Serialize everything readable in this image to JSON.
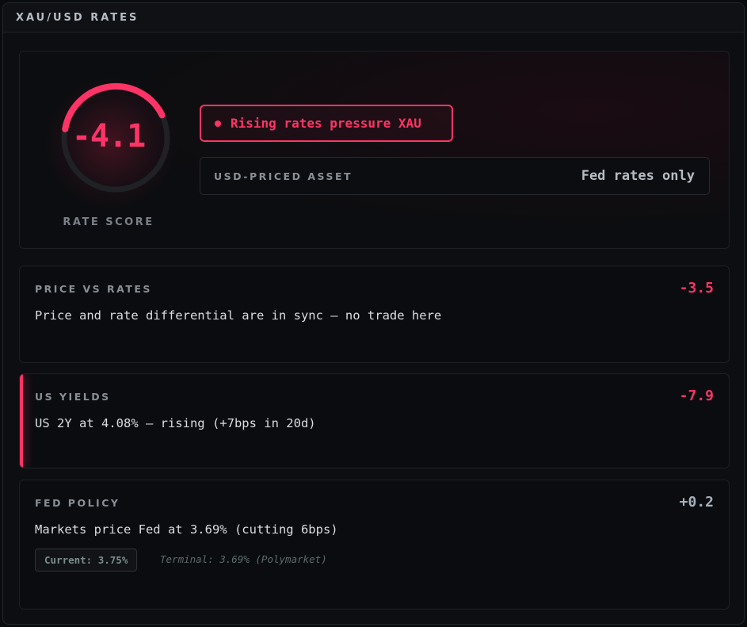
{
  "panel": {
    "title": "XAU/USD RATES"
  },
  "hero": {
    "score": "-4.1",
    "score_label": "RATE SCORE",
    "status": "Rising rates pressure XAU",
    "asset_label": "USD-PRICED ASSET",
    "asset_value": "Fed rates only",
    "accent_color": "#ff3466"
  },
  "cards": [
    {
      "label": "PRICE VS RATES",
      "score": "-3.5",
      "description": "Price and rate differential are in sync — no trade here"
    },
    {
      "label": "US YIELDS",
      "score": "-7.9",
      "description": "US 2Y at 4.08% — rising (+7bps in 20d)"
    },
    {
      "label": "FED POLICY",
      "score": "+0.2",
      "description": "Markets price Fed at 3.69% (cutting 6bps)",
      "current_chip": "Current: 3.75%",
      "terminal_note": "Terminal: 3.69% (Polymarket)"
    }
  ]
}
